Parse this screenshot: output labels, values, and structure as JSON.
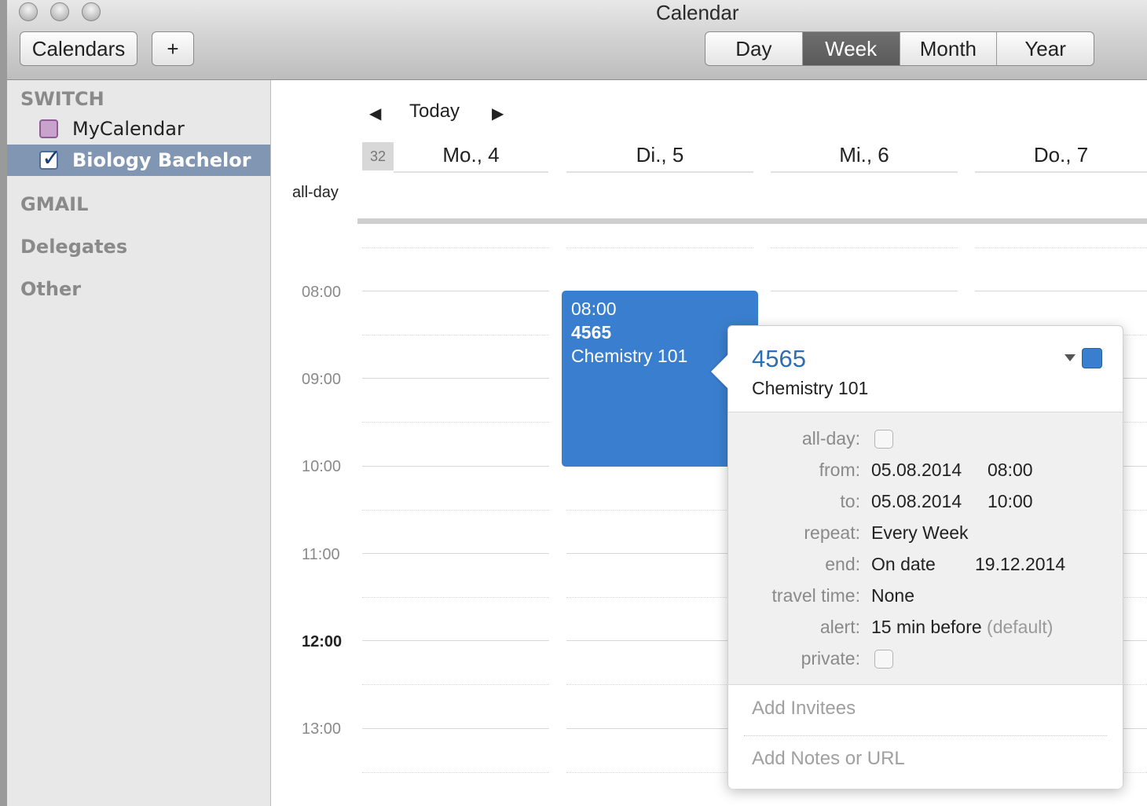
{
  "window": {
    "title": "Calendar"
  },
  "toolbar": {
    "calendars_label": "Calendars",
    "add_label": "+",
    "views": [
      {
        "label": "Day",
        "active": false
      },
      {
        "label": "Week",
        "active": true
      },
      {
        "label": "Month",
        "active": false
      },
      {
        "label": "Year",
        "active": false
      }
    ]
  },
  "sidebar": {
    "groups": [
      {
        "name": "SWITCH"
      },
      {
        "name": "GMAIL"
      },
      {
        "name": "Delegates"
      },
      {
        "name": "Other"
      }
    ],
    "calendars": [
      {
        "name": "MyCalendar",
        "checked": false,
        "color": "#c8a4cc"
      },
      {
        "name": "Biology Bachelor",
        "checked": true,
        "selected": true,
        "color": "#4d6e9c"
      }
    ]
  },
  "nav": {
    "prev_icon": "triangle-left-icon",
    "today_label": "Today",
    "next_icon": "triangle-right-icon"
  },
  "week": {
    "number": "32",
    "days": [
      "Mo., 4",
      "Di., 5",
      "Mi., 6",
      "Do., 7"
    ],
    "allday_label": "all-day",
    "times": [
      "08:00",
      "09:00",
      "10:00",
      "11:00",
      "12:00",
      "13:00"
    ]
  },
  "event": {
    "time": "08:00",
    "code": "4565",
    "title": "Chemistry 101",
    "color": "#3a7fcf"
  },
  "popover": {
    "title": "4565",
    "subtitle": "Chemistry 101",
    "color": "#3a7fcf",
    "rows": {
      "allday_label": "all-day:",
      "from_label": "from:",
      "from_date": "05.08.2014",
      "from_time": "08:00",
      "to_label": "to:",
      "to_date": "05.08.2014",
      "to_time": "10:00",
      "repeat_label": "repeat:",
      "repeat_value": "Every Week",
      "end_label": "end:",
      "end_value": "On date",
      "end_date": "19.12.2014",
      "travel_label": "travel time:",
      "travel_value": "None",
      "alert_label": "alert:",
      "alert_value": "15 min before",
      "alert_suffix": "(default)",
      "private_label": "private:"
    },
    "add_invitees": "Add Invitees",
    "add_notes": "Add Notes or URL"
  }
}
